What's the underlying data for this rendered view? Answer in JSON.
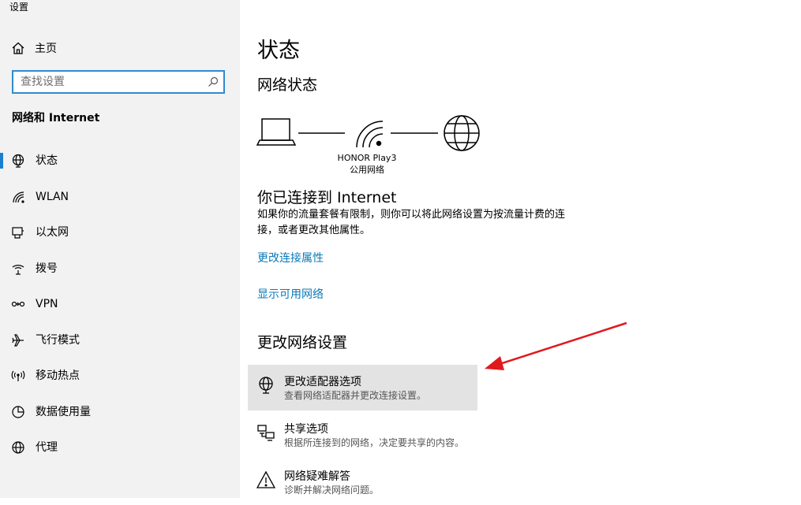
{
  "window": {
    "title": "设置"
  },
  "sidebar": {
    "home_label": "主页",
    "search_placeholder": "查找设置",
    "section_title": "网络和 Internet",
    "items": [
      {
        "label": "状态",
        "icon": "status-globe-icon",
        "selected": true
      },
      {
        "label": "WLAN",
        "icon": "wifi-icon",
        "selected": false
      },
      {
        "label": "以太网",
        "icon": "ethernet-icon",
        "selected": false
      },
      {
        "label": "拨号",
        "icon": "dialup-icon",
        "selected": false
      },
      {
        "label": "VPN",
        "icon": "vpn-icon",
        "selected": false
      },
      {
        "label": "飞行模式",
        "icon": "airplane-icon",
        "selected": false
      },
      {
        "label": "移动热点",
        "icon": "hotspot-icon",
        "selected": false
      },
      {
        "label": "数据使用量",
        "icon": "data-usage-icon",
        "selected": false
      },
      {
        "label": "代理",
        "icon": "proxy-globe-icon",
        "selected": false
      }
    ]
  },
  "main": {
    "title": "状态",
    "network_status_title": "网络状态",
    "network": {
      "name": "HONOR Play3",
      "type": "公用网络"
    },
    "connected_title": "你已连接到 Internet",
    "connected_desc": "如果你的流量套餐有限制，则你可以将此网络设置为按流量计费的连接，或者更改其他属性。",
    "links": {
      "change_props": "更改连接属性",
      "show_networks": "显示可用网络"
    },
    "change_settings_title": "更改网络设置",
    "options": [
      {
        "title": "更改适配器选项",
        "desc": "查看网络适配器并更改连接设置。",
        "icon": "adapter-globe-icon"
      },
      {
        "title": "共享选项",
        "desc": "根据所连接到的网络，决定要共享的内容。",
        "icon": "sharing-icon"
      },
      {
        "title": "网络疑难解答",
        "desc": "诊断并解决网络问题。",
        "icon": "warning-icon"
      }
    ]
  },
  "colors": {
    "accent": "#1b7fd1",
    "link": "#0b79b8",
    "annotation_arrow": "#e0191e",
    "highlight": "#e3e3e3"
  }
}
